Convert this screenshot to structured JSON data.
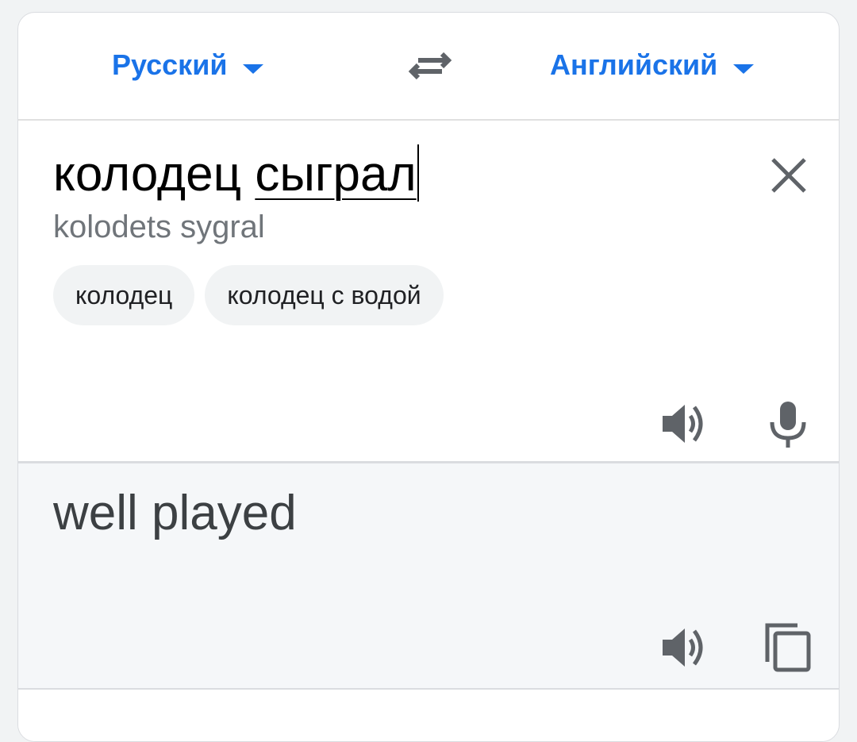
{
  "languages": {
    "source": "Русский",
    "target": "Английский"
  },
  "input": {
    "text_part1": "колодец ",
    "text_part2": "сыграл",
    "transliteration": "kolodets sygral"
  },
  "suggestions": [
    "колодец",
    "колодец с водой"
  ],
  "output": {
    "translation": "well played"
  },
  "icons": {
    "swap": "swap-arrows-icon",
    "clear": "close-icon",
    "listen_source": "speaker-icon",
    "microphone": "microphone-icon",
    "listen_target": "speaker-icon",
    "copy": "copy-icon"
  },
  "colors": {
    "accent": "#1a73e8",
    "icon": "#5f6368",
    "output_bg": "#f5f7f9"
  }
}
